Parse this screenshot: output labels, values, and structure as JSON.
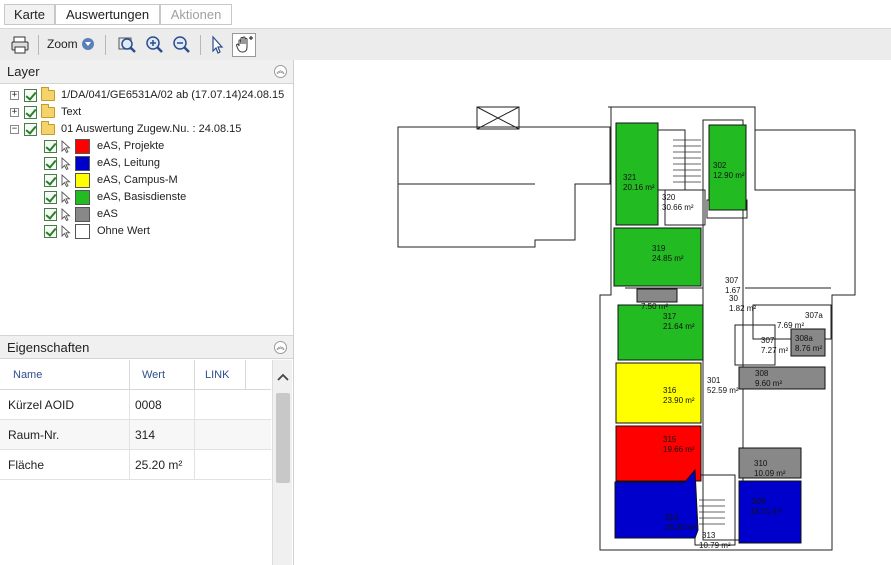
{
  "tabs": [
    {
      "label": "Karte"
    },
    {
      "label": "Auswertungen"
    },
    {
      "label": "Aktionen"
    }
  ],
  "toolbar": {
    "zoom_label": "Zoom"
  },
  "layer_panel": {
    "title": "Layer",
    "items": [
      {
        "label": "1/DA/041/GE6531A/02 ab (17.07.14)24.08.15",
        "expander": "+"
      },
      {
        "label": "Text",
        "expander": "+"
      },
      {
        "label": "01 Auswertung Zugew.Nu. : 24.08.15",
        "expander": "−"
      }
    ],
    "legend": [
      {
        "label": "eAS, Projekte",
        "color": "#ff0000"
      },
      {
        "label": "eAS, Leitung",
        "color": "#0000cc"
      },
      {
        "label": "eAS, Campus-M",
        "color": "#ffff00"
      },
      {
        "label": "eAS, Basisdienste",
        "color": "#22bb22"
      },
      {
        "label": "eAS",
        "color": "#888888"
      },
      {
        "label": "Ohne Wert",
        "color": "#ffffff"
      }
    ]
  },
  "properties_panel": {
    "title": "Eigenschaften",
    "columns": [
      "Name",
      "Wert",
      "LINK"
    ],
    "rows": [
      {
        "name": "Kürzel AOID",
        "value": "0008"
      },
      {
        "name": "Raum-Nr.",
        "value": "314"
      },
      {
        "name": "Fläche",
        "value": "25.20 m²"
      }
    ]
  },
  "floorplan": {
    "colors": {
      "red": "#ff0000",
      "blue": "#0000cc",
      "yellow": "#ffff00",
      "green": "#22bb22",
      "gray": "#888888"
    },
    "rooms": [
      {
        "num": "321",
        "area": "20.16 m²"
      },
      {
        "num": "302",
        "area": "12.90 m²"
      },
      {
        "num": "320",
        "area": "30.66 m²"
      },
      {
        "num": "319",
        "area": "24.85 m²"
      },
      {
        "num": "317",
        "area": "21.64 m²"
      },
      {
        "num": "316",
        "area": "23.90 m²"
      },
      {
        "num": "315",
        "area": "19.66 m²"
      },
      {
        "num": "314",
        "area": "25.20 m²"
      },
      {
        "num": "301",
        "area": "52.59 m²"
      },
      {
        "num": "307a",
        "area": "7.69 m²"
      },
      {
        "num": "308a",
        "area": "8.76 m²"
      },
      {
        "num": "307",
        "area": "7.27 m²"
      },
      {
        "num": "308",
        "area": "9.60 m²"
      },
      {
        "num": "310",
        "area": "10.09 m²"
      },
      {
        "num": "309",
        "area": "18.71 m²"
      },
      {
        "num": "313",
        "area": "10.79 m²"
      },
      {
        "num": "307",
        "area": "1.67"
      },
      {
        "num": "30",
        "area": "1.82 m²"
      },
      {
        "num": "",
        "area": "7.50 m²"
      }
    ]
  }
}
